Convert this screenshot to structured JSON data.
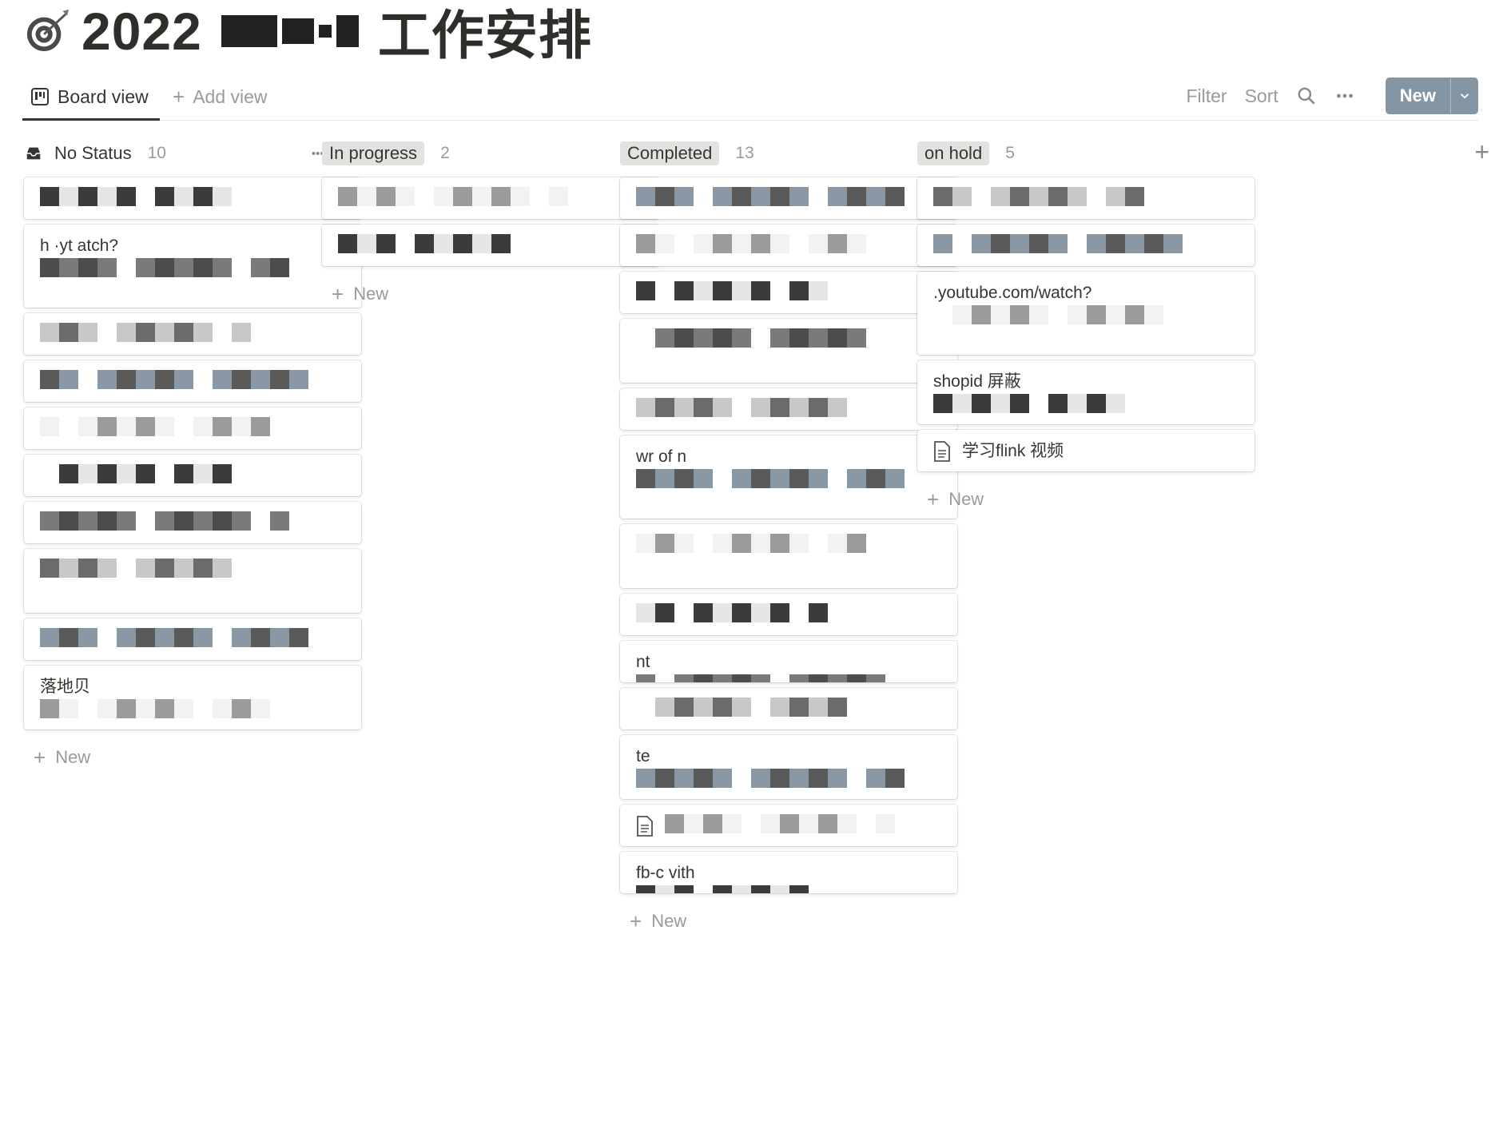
{
  "page": {
    "title_prefix": "2022",
    "title_suffix": "工作安排"
  },
  "views": {
    "active_label": "Board view",
    "add_label": "Add view"
  },
  "toolbar": {
    "filter": "Filter",
    "sort": "Sort",
    "new_label": "New"
  },
  "colors": {
    "accent": "#8495a4",
    "pill": "#e3e2e0",
    "muted": "#9b9a97"
  },
  "columns": [
    {
      "name": "No Status",
      "count": "10",
      "pill": false,
      "cards": [
        {
          "text": "",
          "rows": 1
        },
        {
          "text": "h                ·yt                    atch?",
          "rows": 3
        },
        {
          "text": "",
          "rows": 1
        },
        {
          "text": "",
          "rows": 1
        },
        {
          "text": "",
          "rows": 1
        },
        {
          "text": "",
          "rows": 1
        },
        {
          "text": "",
          "rows": 1
        },
        {
          "text": "",
          "rows": 2
        },
        {
          "text": "",
          "rows": 1
        },
        {
          "text": "落地贝",
          "rows": 2
        }
      ],
      "add_label": "New"
    },
    {
      "name": "In progress",
      "count": "2",
      "pill": true,
      "cards": [
        {
          "text": "",
          "rows": 1
        },
        {
          "text": "",
          "rows": 1
        }
      ],
      "add_label": "New"
    },
    {
      "name": "Completed",
      "count": "13",
      "pill": true,
      "cards": [
        {
          "text": "",
          "rows": 1
        },
        {
          "text": "",
          "rows": 1
        },
        {
          "text": "",
          "rows": 1
        },
        {
          "text": "",
          "rows": 2
        },
        {
          "text": "",
          "rows": 1
        },
        {
          "text": "wr of n",
          "rows": 3
        },
        {
          "text": "",
          "rows": 2
        },
        {
          "text": "",
          "rows": 1
        },
        {
          "text": "nt",
          "rows": 1
        },
        {
          "text": "",
          "rows": 1
        },
        {
          "text": "te",
          "rows": 2
        },
        {
          "text": "",
          "rows": 1,
          "doc": true
        },
        {
          "text": "fb-c          vith",
          "rows": 1
        }
      ],
      "add_label": "New"
    },
    {
      "name": "on hold",
      "count": "5",
      "pill": true,
      "cards": [
        {
          "text": "",
          "rows": 1
        },
        {
          "text": "",
          "rows": 1
        },
        {
          "text": ".youtube.com/watch?",
          "rows": 3
        },
        {
          "text": "shopid 屏蔽",
          "rows": 2
        },
        {
          "text": "学习flink 视频",
          "rows": 1,
          "doc": true
        }
      ],
      "add_label": "New"
    }
  ]
}
